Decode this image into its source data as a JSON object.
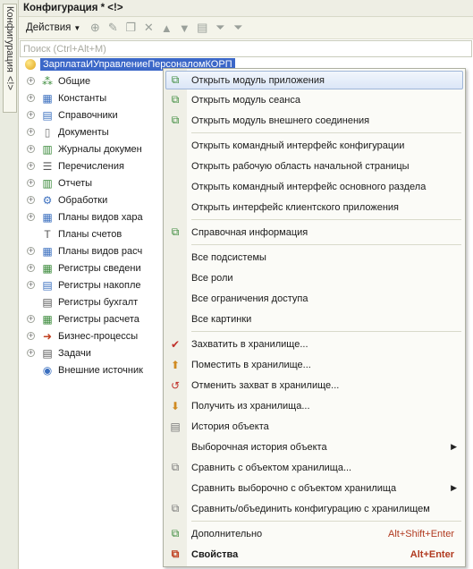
{
  "side_tab": {
    "label": "Конфигурация",
    "extra": "<!>"
  },
  "title": "Конфигурация * <!>",
  "toolbar": {
    "actions_label": "Действия"
  },
  "search": {
    "placeholder": "Поиск (Ctrl+Alt+M)"
  },
  "tree": {
    "root": "ЗарплатаИУправлениеПерсоналомКОРП",
    "items": [
      {
        "label": "Общие",
        "icon": "common-icon"
      },
      {
        "label": "Константы",
        "icon": "constants-icon"
      },
      {
        "label": "Справочники",
        "icon": "catalogs-icon"
      },
      {
        "label": "Документы",
        "icon": "documents-icon"
      },
      {
        "label": "Журналы докумен",
        "icon": "journals-icon"
      },
      {
        "label": "Перечисления",
        "icon": "enums-icon"
      },
      {
        "label": "Отчеты",
        "icon": "reports-icon"
      },
      {
        "label": "Обработки",
        "icon": "processing-icon"
      },
      {
        "label": "Планы видов хара",
        "icon": "chart-types-icon"
      },
      {
        "label": "Планы счетов",
        "icon": "chart-accounts-icon"
      },
      {
        "label": "Планы видов расч",
        "icon": "calc-types-icon"
      },
      {
        "label": "Регистры сведени",
        "icon": "info-registers-icon"
      },
      {
        "label": "Регистры накопле",
        "icon": "accum-registers-icon"
      },
      {
        "label": "Регистры бухгалт",
        "icon": "acc-registers-icon"
      },
      {
        "label": "Регистры расчета",
        "icon": "calc-registers-icon"
      },
      {
        "label": "Бизнес-процессы",
        "icon": "business-process-icon"
      },
      {
        "label": "Задачи",
        "icon": "tasks-icon"
      },
      {
        "label": "Внешние источник",
        "icon": "external-sources-icon"
      }
    ]
  },
  "menu": {
    "items": [
      {
        "label": "Открыть модуль приложения"
      },
      {
        "label": "Открыть модуль сеанса"
      },
      {
        "label": "Открыть модуль внешнего соединения"
      },
      {
        "label": "Открыть командный интерфейс конфигурации"
      },
      {
        "label": "Открыть рабочую область начальной страницы"
      },
      {
        "label": "Открыть командный интерфейс основного раздела"
      },
      {
        "label": "Открыть интерфейс клиентского приложения"
      },
      {
        "label": "Справочная информация"
      },
      {
        "label": "Все подсистемы"
      },
      {
        "label": "Все роли"
      },
      {
        "label": "Все ограничения доступа"
      },
      {
        "label": "Все картинки"
      },
      {
        "label": "Захватить в хранилище..."
      },
      {
        "label": "Поместить в хранилище..."
      },
      {
        "label": "Отменить захват в хранилище..."
      },
      {
        "label": "Получить из хранилища..."
      },
      {
        "label": "История объекта"
      },
      {
        "label": "Выборочная история объекта"
      },
      {
        "label": "Сравнить с объектом хранилища..."
      },
      {
        "label": "Сравнить выборочно с объектом хранилища"
      },
      {
        "label": "Сравнить/объединить конфигурацию с хранилищем"
      },
      {
        "label": "Дополнительно",
        "shortcut": "Alt+Shift+Enter"
      },
      {
        "label": "Свойства",
        "shortcut": "Alt+Enter"
      }
    ]
  }
}
